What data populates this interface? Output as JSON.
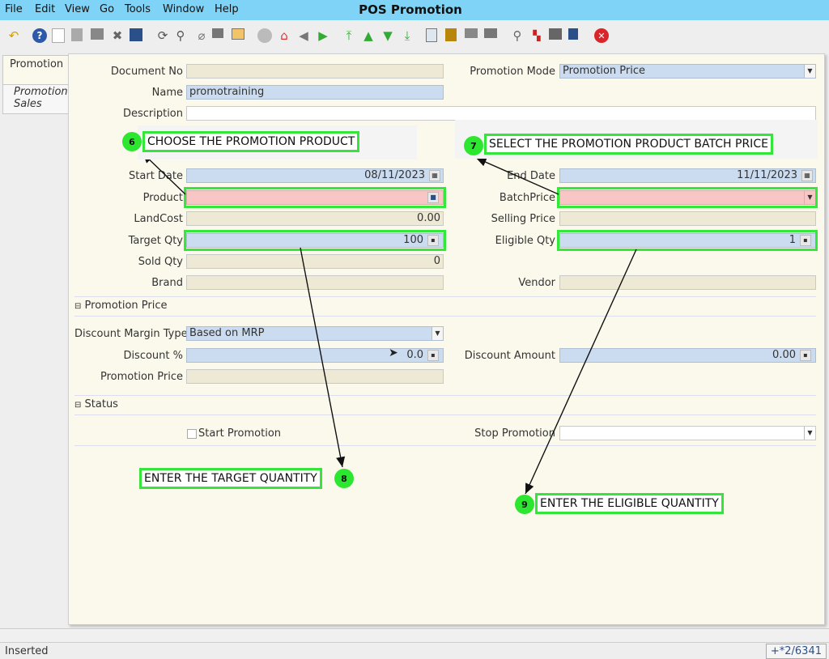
{
  "app": {
    "title": "POS Promotion"
  },
  "menu": [
    "File",
    "Edit",
    "View",
    "Go",
    "Tools",
    "Window",
    "Help"
  ],
  "toolbar": {
    "icons": [
      "undo-icon",
      "help-icon",
      "new-icon",
      "copy-icon",
      "delete-icon",
      "delete-selection-icon",
      "save-icon",
      "refresh-icon",
      "find-icon",
      "attachment-icon",
      "chat-icon",
      "grid-toggle-icon",
      "history-icon",
      "home-icon",
      "back-icon",
      "forward-icon",
      "first-record-icon",
      "previous-record-icon",
      "next-record-icon",
      "last-record-icon",
      "report-icon",
      "archive-icon",
      "print-preview-icon",
      "print-icon",
      "zoom-icon",
      "workflow-icon",
      "product-info-icon",
      "lock-icon",
      "close-icon"
    ]
  },
  "tabs": [
    {
      "label": "Promotion"
    },
    {
      "label": "Promotion Sales"
    }
  ],
  "form": {
    "document_no": {
      "label": "Document No",
      "value": ""
    },
    "name": {
      "label": "Name",
      "value": "promotraining"
    },
    "description": {
      "label": "Description",
      "value": ""
    },
    "promotion_mode": {
      "label": "Promotion Mode",
      "value": "Promotion Price"
    },
    "start_date": {
      "label": "Start Date",
      "value": "08/11/2023"
    },
    "end_date": {
      "label": "End Date",
      "value": "11/11/2023"
    },
    "product": {
      "label": "Product",
      "value": ""
    },
    "batch_price": {
      "label": "BatchPrice",
      "value": ""
    },
    "land_cost": {
      "label": "LandCost",
      "value": "0.00"
    },
    "selling_price": {
      "label": "Selling Price",
      "value": ""
    },
    "target_qty": {
      "label": "Target Qty",
      "value": "100"
    },
    "eligible_qty": {
      "label": "Eligible Qty",
      "value": "1"
    },
    "sold_qty": {
      "label": "Sold Qty",
      "value": "0"
    },
    "brand": {
      "label": "Brand",
      "value": ""
    },
    "vendor": {
      "label": "Vendor",
      "value": ""
    }
  },
  "section_promotion_price": {
    "title": "Promotion Price",
    "discount_margin_type": {
      "label": "Discount Margin Type",
      "value": "Based on MRP"
    },
    "discount_pct": {
      "label": "Discount %",
      "value": "0.0"
    },
    "discount_amount": {
      "label": "Discount Amount",
      "value": "0.00"
    },
    "promotion_price": {
      "label": "Promotion Price",
      "value": ""
    }
  },
  "section_status": {
    "title": "Status",
    "start_promotion": {
      "label": "Start Promotion",
      "checked": false
    },
    "stop_promotion": {
      "label": "Stop Promotion",
      "value": ""
    }
  },
  "callouts": [
    {
      "num": "6",
      "text": "CHOOSE THE PROMOTION PRODUCT"
    },
    {
      "num": "7",
      "text": "SELECT THE PROMOTION PRODUCT BATCH PRICE"
    },
    {
      "num": "8",
      "text": "ENTER THE TARGET QUANTITY"
    },
    {
      "num": "9",
      "text": "ENTER THE ELIGIBLE QUANTITY"
    }
  ],
  "status": {
    "text": "Inserted",
    "record": "+*2/6341"
  },
  "colors": {
    "titlebar": "#7fd3f6",
    "mandatory_field": "#cbdcf0",
    "error_field": "#f9c6c6",
    "readonly_field": "#ede9d5",
    "highlight": "#34e83b"
  }
}
